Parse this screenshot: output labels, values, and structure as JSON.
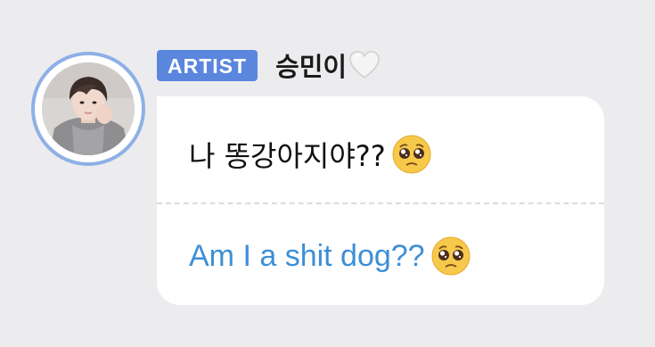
{
  "post": {
    "badge": "ARTIST",
    "sender_name": "승민이",
    "sender_emoji": "white-heart-icon",
    "original_text": "나 똥강아지야??",
    "translated_text": "Am I a shit dog??",
    "message_emoji": "pleading-face-icon"
  },
  "colors": {
    "background": "#ececef",
    "badge": "#5b86de",
    "avatar_ring": "#8fb0e6",
    "translation_text": "#3d8fd6",
    "bubble": "#ffffff"
  }
}
